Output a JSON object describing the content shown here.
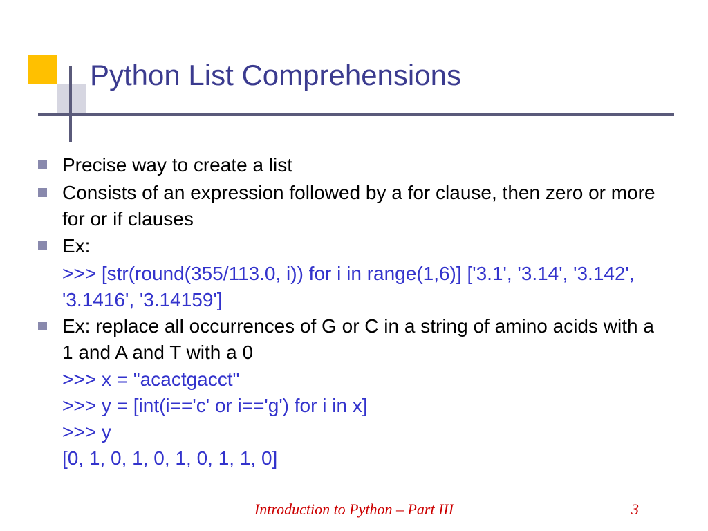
{
  "title": "Python List Comprehensions",
  "bullets": {
    "b1": "Precise way to create a list",
    "b2": "Consists of an expression followed by a for clause, then zero or more for or if clauses",
    "b3": "Ex:",
    "b3_code": ">>> [str(round(355/113.0, i)) for i in range(1,6)] ['3.1', '3.14', '3.142', '3.1416', '3.14159']",
    "b4": "Ex:  replace all occurrences of G or C in a string of amino acids with a 1 and A and T with a 0",
    "b4_code1": ">>> x = \"acactgacct\"",
    "b4_code2": ">>> y = [int(i=='c' or i=='g') for i in x]",
    "b4_code3": ">>> y",
    "b4_code4": "[0, 1, 0, 1, 0, 1, 0, 1, 1, 0]"
  },
  "footer": {
    "title": "Introduction to Python – Part III",
    "page": "3"
  }
}
